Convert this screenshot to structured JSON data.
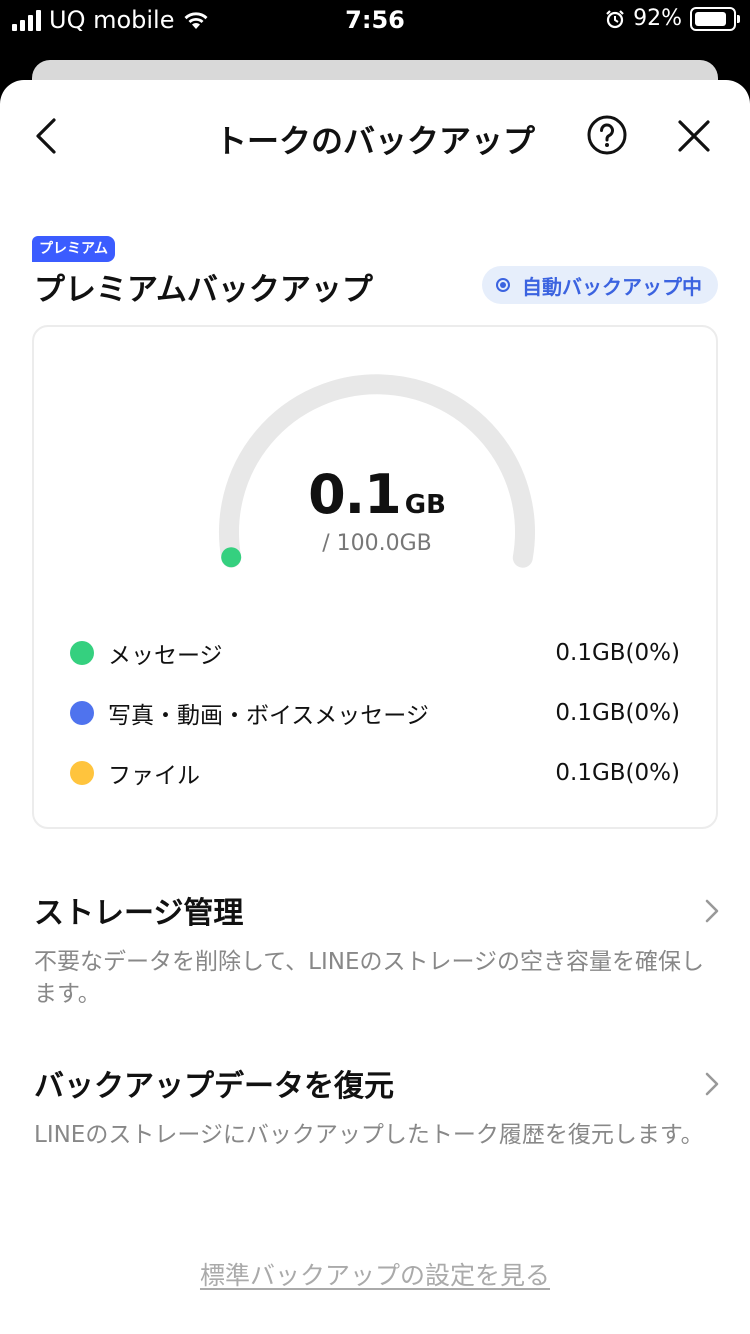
{
  "status": {
    "carrier": "UQ mobile",
    "time": "7:56",
    "battery": "92%",
    "battery_level": 0.92
  },
  "nav": {
    "title": "トークのバックアップ"
  },
  "premium": {
    "badge": "プレミアム",
    "title": "プレミアムバックアップ",
    "auto_status": "自動バックアップ中"
  },
  "usage": {
    "used_value": "0.1",
    "used_unit": "GB",
    "total": "/ 100.0GB",
    "used_fraction": 0.001
  },
  "legend": [
    {
      "label": "メッセージ",
      "value": "0.1GB(0%)",
      "color": "#35d07f"
    },
    {
      "label": "写真・動画・ボイスメッセージ",
      "value": "0.1GB(0%)",
      "color": "#4f73ee"
    },
    {
      "label": "ファイル",
      "value": "0.1GB(0%)",
      "color": "#ffc43d"
    }
  ],
  "menu": [
    {
      "title": "ストレージ管理",
      "desc": "不要なデータを削除して、LINEのストレージの空き容量を確保します。"
    },
    {
      "title": "バックアップデータを復元",
      "desc": "LINEのストレージにバックアップしたトーク履歴を復元します。"
    }
  ],
  "footer": {
    "link": "標準バックアップの設定を見る"
  },
  "colors": {
    "accent": "#3b5cff",
    "gauge_track": "#e8e8e8",
    "gauge_fill": "#35d07f"
  }
}
